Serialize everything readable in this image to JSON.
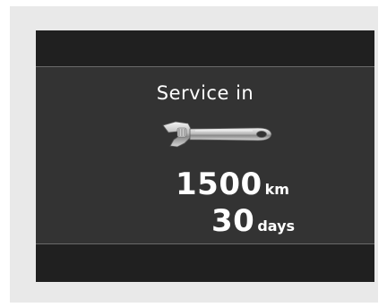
{
  "service": {
    "title": "Service in",
    "distance": {
      "value": "1500",
      "unit": "km"
    },
    "time": {
      "value": "30",
      "unit": "days"
    },
    "icon": "wrench-icon"
  },
  "colors": {
    "display_background": "#333333",
    "band_background": "#202020",
    "text": "#ffffff"
  }
}
